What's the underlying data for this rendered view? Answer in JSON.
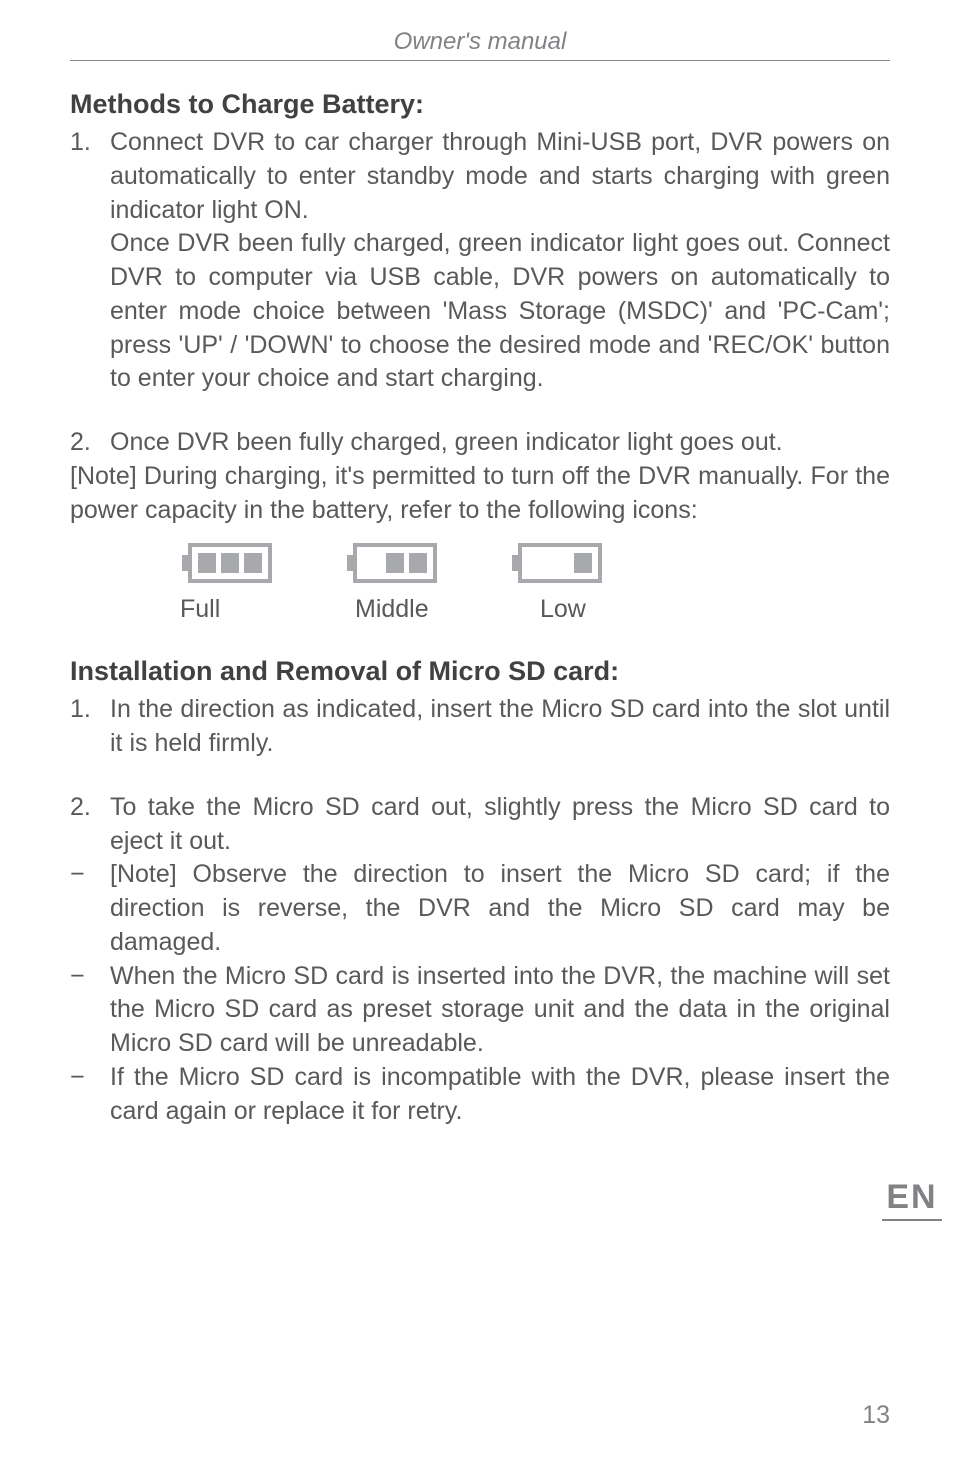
{
  "header": {
    "title": "Owner's manual"
  },
  "section1": {
    "title": "Methods to Charge Battery:",
    "items": [
      {
        "marker": "1.",
        "text": "Connect DVR to car charger through Mini-USB port, DVR powers on automatically to enter standby mode and starts charging with green indicator light ON."
      }
    ],
    "para1": "Once DVR been fully charged, green indicator light goes out. Connect DVR to computer via USB cable, DVR powers on automatically to enter mode choice between 'Mass Storage (MSDC)' and 'PC-Cam'; press 'UP' / 'DOWN' to choose the desired mode and 'REC/OK' button to enter your choice and start charging.",
    "items2": [
      {
        "marker": "2.",
        "text": "Once DVR been fully charged, green indicator light goes out."
      }
    ],
    "note": "[Note] During charging, it's permitted to turn off the DVR manually. For the power capacity in the battery, refer to the following icons:",
    "battery_labels": [
      "Full",
      "Middle",
      "Low"
    ]
  },
  "section2": {
    "title": "Installation and Removal of Micro SD card:",
    "items": [
      {
        "marker": "1.",
        "text": "In the direction as indicated, insert the Micro SD card into the slot until it is held firmly."
      },
      {
        "marker": "2.",
        "text": "To take the Micro SD card out, slightly press the Micro SD card to eject it out."
      },
      {
        "marker": "−",
        "text": "[Note] Observe the direction to insert the Micro SD card; if the direction is reverse, the DVR and the Micro SD card may be damaged."
      },
      {
        "marker": "−",
        "text": "When the Micro SD card is inserted into the DVR, the machine will set the Micro SD card as preset storage unit and the data in the original Micro SD card will be unreadable."
      },
      {
        "marker": "−",
        "text": "If the Micro SD card is incompatible with the DVR, please insert the card again or replace it for retry."
      }
    ]
  },
  "lang_tag": "EN",
  "page_number": "13"
}
